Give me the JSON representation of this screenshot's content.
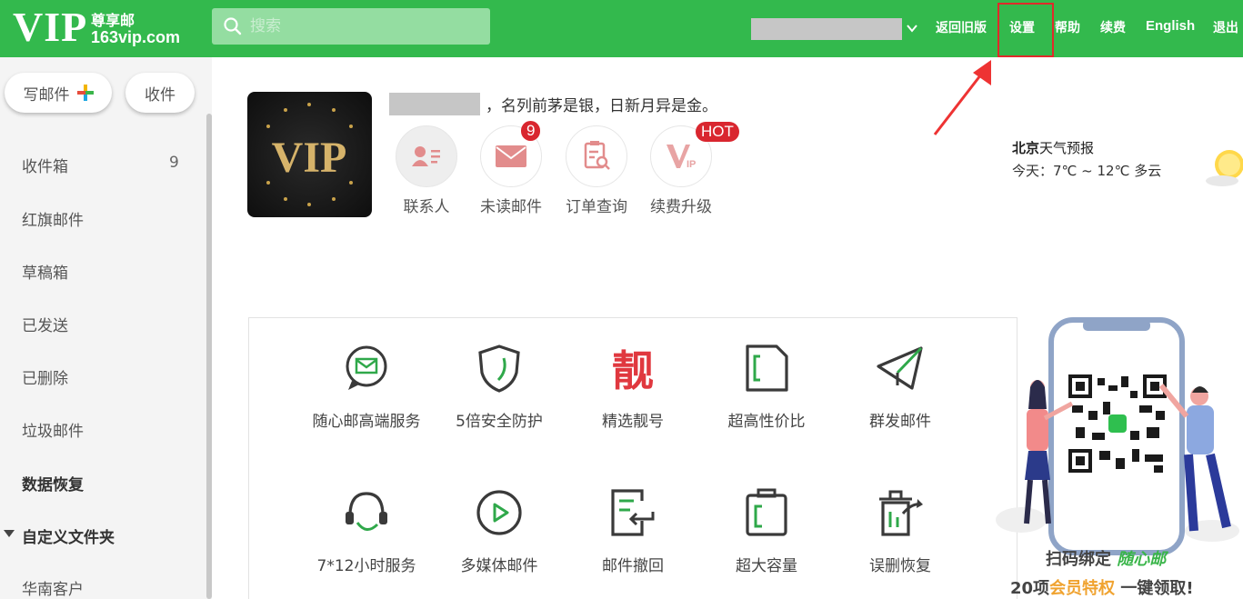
{
  "header": {
    "logo_main": "VIP",
    "logo_sub1": "尊享邮",
    "logo_sub2": "163vip.com",
    "search_placeholder": "搜索",
    "nav": [
      "返回旧版",
      "设置",
      "帮助",
      "续费",
      "English",
      "退出"
    ],
    "highlighted_nav": "设置"
  },
  "sidebar": {
    "compose": "写邮件",
    "receive": "收件",
    "folders": [
      {
        "label": "收件箱",
        "count": "9"
      },
      {
        "label": "红旗邮件"
      },
      {
        "label": "草稿箱"
      },
      {
        "label": "已发送"
      },
      {
        "label": "已删除"
      },
      {
        "label": "垃圾邮件"
      },
      {
        "label": "数据恢复"
      }
    ],
    "custom_folders": "自定义文件夹",
    "custom_items": [
      "华南客户"
    ]
  },
  "profile": {
    "vip_badge": "VIP",
    "greeting": "，名列前茅是银，日新月异是金。",
    "quick_actions": [
      {
        "label": "联系人",
        "icon": "contact-card-icon"
      },
      {
        "label": "未读邮件",
        "icon": "envelope-icon",
        "badge": "9"
      },
      {
        "label": "订单查询",
        "icon": "order-search-icon"
      },
      {
        "label": "续费升级",
        "icon": "vip-renew-icon",
        "badge": "HOT"
      }
    ]
  },
  "weather": {
    "city": "北京",
    "title_suffix": "天气预报",
    "today": "今天：7℃ ~ 12℃ 多云"
  },
  "features": [
    {
      "label": "随心邮高端服务",
      "icon": "chat-mail-icon"
    },
    {
      "label": "5倍安全防护",
      "icon": "shield-icon"
    },
    {
      "label": "精选靓号",
      "icon": "pretty-number-icon",
      "glyph": "靓"
    },
    {
      "label": "超高性价比",
      "icon": "sim-card-icon"
    },
    {
      "label": "群发邮件",
      "icon": "paper-plane-icon"
    },
    {
      "label": "7*12小时服务",
      "icon": "headset-icon"
    },
    {
      "label": "多媒体邮件",
      "icon": "play-icon"
    },
    {
      "label": "邮件撤回",
      "icon": "recall-icon"
    },
    {
      "label": "超大容量",
      "icon": "storage-icon"
    },
    {
      "label": "误删恢复",
      "icon": "trash-restore-icon"
    }
  ],
  "promo": {
    "line1_a": "扫码绑定",
    "line1_b": "随心邮",
    "line2_a": "20项",
    "line2_b": "会员特权",
    "line2_c": "一键领取!"
  },
  "colors": {
    "brand_green": "#33b94d",
    "badge_red": "#d9262f",
    "highlight_border": "#e02a2a",
    "promo_accent": "#f0a330"
  }
}
